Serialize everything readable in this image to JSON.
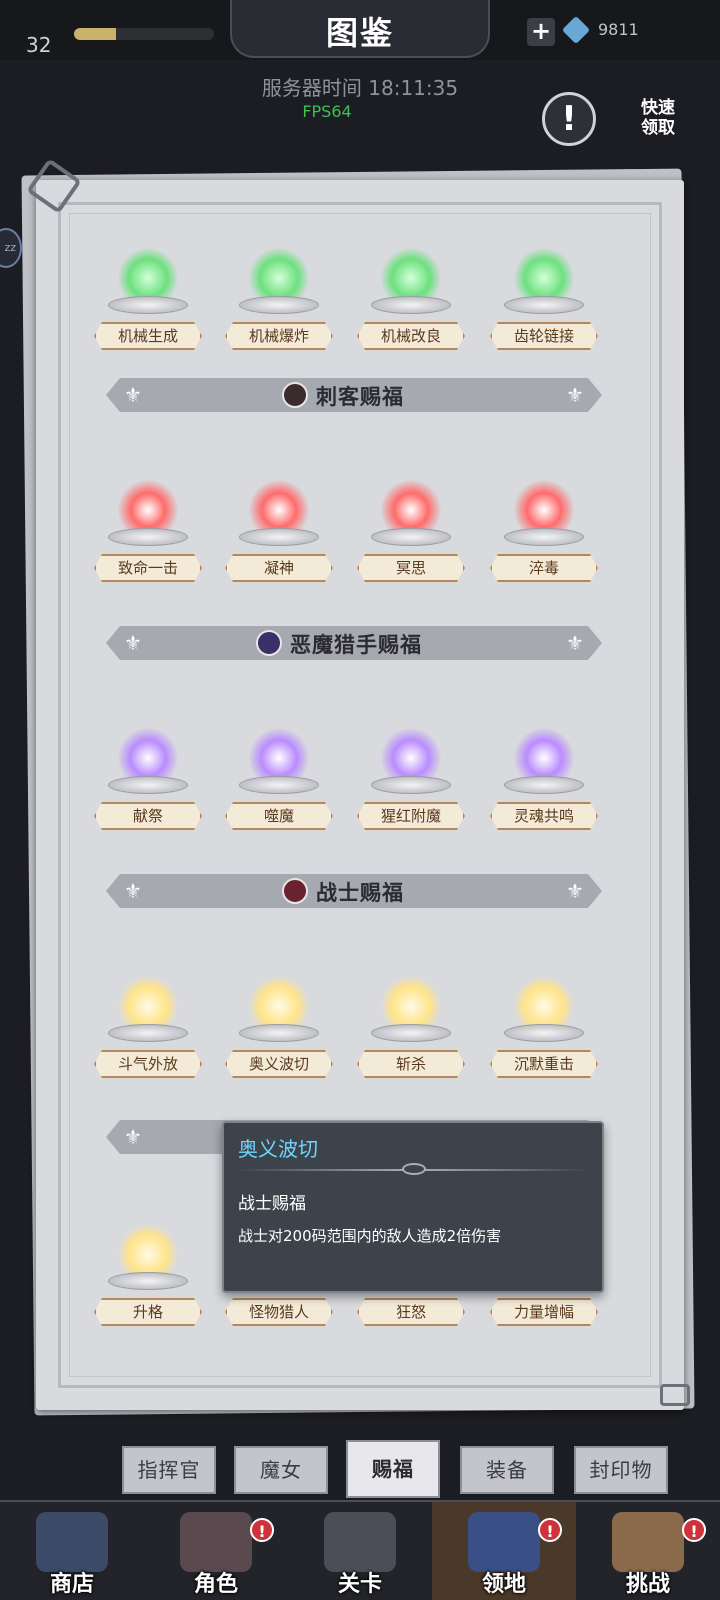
{
  "hud": {
    "level": "32",
    "xp_fraction": 0.3,
    "title": "图鉴",
    "add_icon": "plus-icon",
    "gem_icon": "diamond-icon",
    "gem_count": "9811"
  },
  "status": {
    "server_time": "服务器时间 18:11:35",
    "fps": "FPS64"
  },
  "quick_claim": "快速\n领取",
  "info_icon": "exclamation-icon",
  "sections": [
    {
      "banner": null,
      "skills": [
        "机械生成",
        "机械爆炸",
        "机械改良",
        "齿轮链接"
      ],
      "color": "#6de07f"
    },
    {
      "banner": "刺客赐福",
      "skills": [
        "致命一击",
        "凝神",
        "冥思",
        "淬毒"
      ],
      "color": "#ff6b6b"
    },
    {
      "banner": "恶魔猎手赐福",
      "skills": [
        "献祭",
        "噬魔",
        "猩红附魔",
        "灵魂共鸣"
      ],
      "color": "#b98cff"
    },
    {
      "banner": "战士赐福",
      "skills": [
        "斗气外放",
        "奥义波切",
        "斩杀",
        "沉默重击"
      ],
      "color": "#ffe48a"
    },
    {
      "banner": "",
      "skills": [
        "升格",
        "怪物猎人",
        "狂怒",
        "力量增幅"
      ],
      "color": "#ffe48a"
    }
  ],
  "tooltip": {
    "name": "奥义波切",
    "category": "战士赐福",
    "description": "战士对200码范围内的敌人造成2倍伤害"
  },
  "tabs": [
    "指挥官",
    "魔女",
    "赐福",
    "装备",
    "封印物"
  ],
  "active_tab": "赐福",
  "nav": [
    {
      "label": "商店",
      "icon": "shop-icon",
      "badge": ""
    },
    {
      "label": "角色",
      "icon": "character-icon",
      "badge": "!"
    },
    {
      "label": "关卡",
      "icon": "swords-icon",
      "badge": ""
    },
    {
      "label": "领地",
      "icon": "castle-icon",
      "badge": "!"
    },
    {
      "label": "挑战",
      "icon": "challenge-map-icon",
      "badge": "!"
    }
  ]
}
